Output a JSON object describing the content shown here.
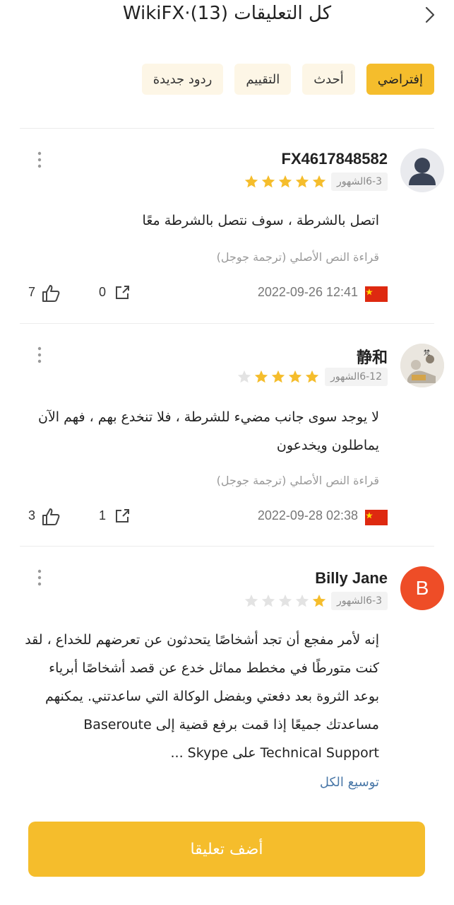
{
  "header": {
    "title": "كل التعليقات (13)·WikiFX"
  },
  "filters": [
    {
      "label": "إفتراضي",
      "active": true
    },
    {
      "label": "أحدث",
      "active": false
    },
    {
      "label": "التقييم",
      "active": false
    },
    {
      "label": "ردود جديدة",
      "active": false
    }
  ],
  "reviews": [
    {
      "username": "FX4617848582",
      "avatar": "default-user",
      "time_badge": "6-3الشهور",
      "rating": 5,
      "text": "اتصل بالشرطة ، سوف نتصل بالشرطة معًا",
      "translate": "قراءة النص الأصلي (ترجمة جوجل)",
      "datetime": "2022-09-26 12:41",
      "flag": "china",
      "shares": "0",
      "likes": "7"
    },
    {
      "username": "静和",
      "avatar": "photo",
      "time_badge": "6-12الشهور",
      "rating": 4,
      "text": "لا يوجد سوى جانب مضيء للشرطة ، فلا تنخدع بهم ، فهم الآن يماطلون ويخدعون",
      "translate": "قراءة النص الأصلي (ترجمة جوجل)",
      "datetime": "2022-09-28 02:38",
      "flag": "china",
      "shares": "1",
      "likes": "3"
    },
    {
      "username": "Billy Jane",
      "avatar": "B",
      "time_badge": "6-3الشهور",
      "rating": 1,
      "text": "إنه لأمر مفجع أن تجد أشخاصًا يتحدثون عن تعرضهم للخداع ، لقد كنت متورطًا في مخطط مماثل خدع عن قصد أشخاصًا أبرياء بوعد الثروة بعد دفعتي وبفضل الوكالة التي ساعدتني. يمكنهم مساعدتك جميعًا إذا قمت برفع قضية إلى Baseroute Technical Support على Skype ...",
      "expand": "توسيع الكل"
    }
  ],
  "add_comment": "أضف تعليقا",
  "colors": {
    "accent": "#f5bd2c",
    "star_on": "#f5bd2c",
    "star_off": "#e3e3e3",
    "avatar_letter_bg": "#ee4d27"
  }
}
